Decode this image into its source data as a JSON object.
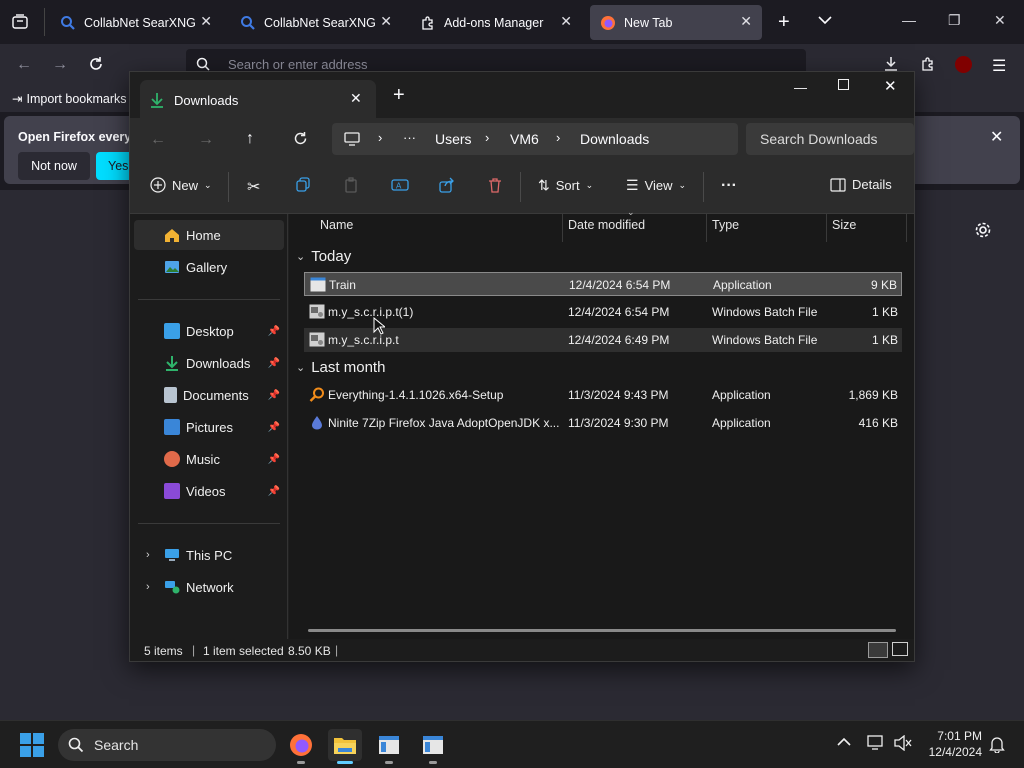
{
  "firefox": {
    "tabs": [
      {
        "label": "CollabNet SearXNG",
        "icon": "searxng-icon"
      },
      {
        "label": "CollabNet SearXNG",
        "icon": "searxng-icon"
      },
      {
        "label": "Add-ons Manager",
        "icon": "puzzle-icon"
      },
      {
        "label": "New Tab",
        "icon": "firefox-icon"
      }
    ],
    "address_placeholder": "Search or enter address",
    "import_bookmarks": "Import bookmarks",
    "notification": {
      "text": "Open Firefox every",
      "not_now": "Not now",
      "yes": "Yes"
    }
  },
  "explorer": {
    "tab_title": "Downloads",
    "breadcrumb": [
      "Users",
      "VM6",
      "Downloads"
    ],
    "breadcrumb_more": "···",
    "search_placeholder": "Search Downloads",
    "toolbar": {
      "new": "New",
      "sort": "Sort",
      "view": "View",
      "more": "···",
      "details": "Details"
    },
    "sidebar": {
      "top": [
        {
          "label": "Home",
          "icon": "home-icon",
          "color": "#f2b233"
        },
        {
          "label": "Gallery",
          "icon": "gallery-icon",
          "color": "#4ea3e8"
        }
      ],
      "pinned": [
        {
          "label": "Desktop",
          "icon": "desktop-icon",
          "color": "#3aa0e8"
        },
        {
          "label": "Downloads",
          "icon": "download-icon",
          "color": "#2fb36b"
        },
        {
          "label": "Documents",
          "icon": "documents-icon",
          "color": "#b8c4d0"
        },
        {
          "label": "Pictures",
          "icon": "pictures-icon",
          "color": "#3a86d8"
        },
        {
          "label": "Music",
          "icon": "music-icon",
          "color": "#e06a4a"
        },
        {
          "label": "Videos",
          "icon": "videos-icon",
          "color": "#8a4ad8"
        }
      ],
      "bottom": [
        {
          "label": "This PC",
          "icon": "pc-icon",
          "color": "#3aa0e8"
        },
        {
          "label": "Network",
          "icon": "network-icon",
          "color": "#3aa0e8"
        }
      ]
    },
    "columns": {
      "name": "Name",
      "date": "Date modified",
      "type": "Type",
      "size": "Size"
    },
    "groups": [
      {
        "label": "Today",
        "files": [
          {
            "name": "Train",
            "date": "12/4/2024 6:54 PM",
            "type": "Application",
            "size": "9 KB",
            "icon": "app-window-icon"
          },
          {
            "name": "m.y_s.c.r.i.p.t(1)",
            "date": "12/4/2024 6:54 PM",
            "type": "Windows Batch File",
            "size": "1 KB",
            "icon": "batch-file-icon"
          },
          {
            "name": "m.y_s.c.r.i.p.t",
            "date": "12/4/2024 6:49 PM",
            "type": "Windows Batch File",
            "size": "1 KB",
            "icon": "batch-file-icon"
          }
        ]
      },
      {
        "label": "Last month",
        "files": [
          {
            "name": "Everything-1.4.1.1026.x64-Setup",
            "date": "11/3/2024 9:43 PM",
            "type": "Application",
            "size": "1,869 KB",
            "icon": "everything-icon"
          },
          {
            "name": "Ninite 7Zip Firefox Java AdoptOpenJDK x...",
            "date": "11/3/2024 9:30 PM",
            "type": "Application",
            "size": "416 KB",
            "icon": "ninite-icon"
          }
        ]
      }
    ],
    "status": {
      "items": "5 items",
      "selected": "1 item selected",
      "size": "8.50 KB"
    }
  },
  "taskbar": {
    "search": "Search",
    "time": "7:01 PM",
    "date": "12/4/2024"
  }
}
